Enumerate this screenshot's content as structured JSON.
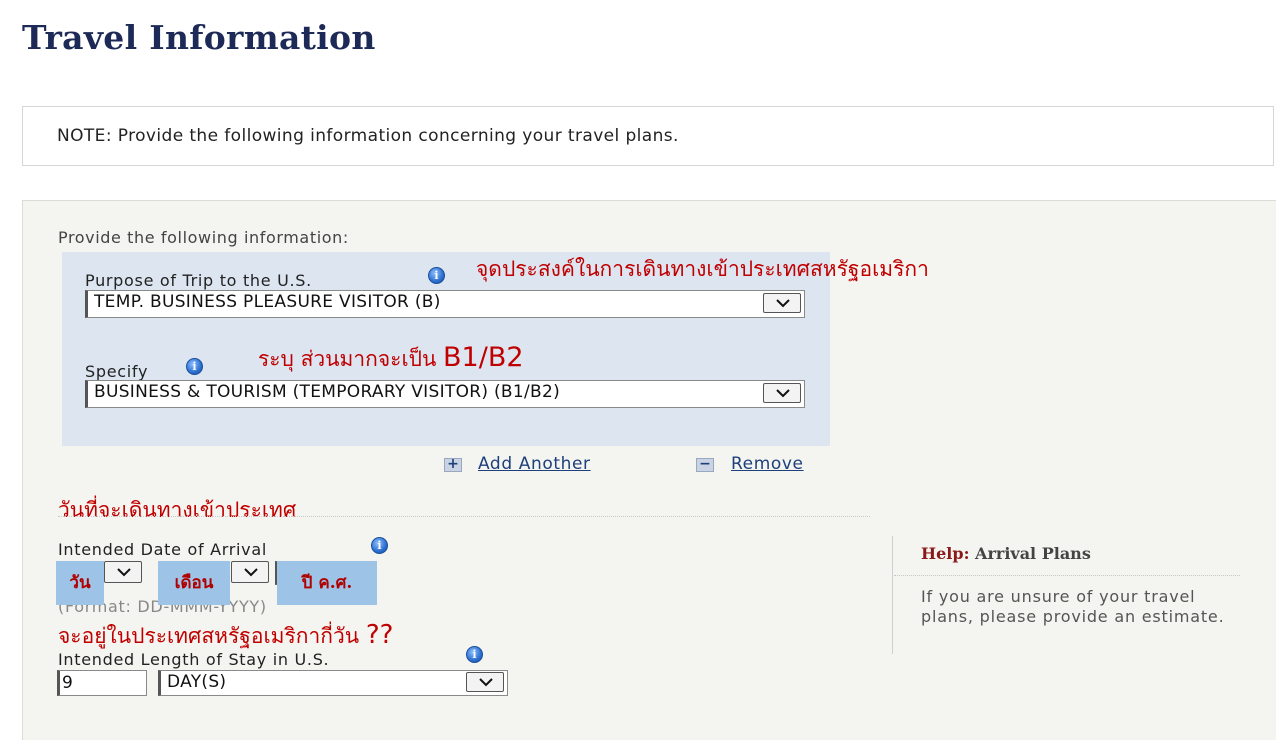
{
  "page": {
    "title": "Travel Information"
  },
  "note": {
    "text": "NOTE: Provide the following information concerning your travel plans."
  },
  "form": {
    "provide_label": "Provide the following information:",
    "purpose": {
      "label": "Purpose of Trip to the U.S.",
      "value": "TEMP. BUSINESS PLEASURE VISITOR (B)"
    },
    "specify": {
      "label": "Specify",
      "value": "BUSINESS & TOURISM (TEMPORARY VISITOR) (B1/B2)"
    },
    "add_another": "Add Another",
    "remove": "Remove",
    "arrival": {
      "label": "Intended Date of Arrival",
      "format": "(Format: DD-MMM-YYYY)"
    },
    "stay": {
      "label": "Intended Length of Stay in U.S.",
      "value": "9",
      "unit": "DAY(S)"
    }
  },
  "help": {
    "title_prefix": "Help:",
    "title_rest": " Arrival Plans",
    "text": "If you are unsure of your travel plans, please provide an estimate."
  },
  "annotations": {
    "purpose_note": "จุดประสงค์ในการเดินทางเข้าประเทศสหรัฐอเมริกา",
    "specify_note_thai": "ระบุ ส่วนมากจะเป็น ",
    "specify_note_code": "B1/B2",
    "arrival_note": "วันที่จะเดินทางเข้าประเทศ",
    "stay_note_thai": "จะอยู่ในประเทศสหรัฐอเมริกากี่วัน ",
    "stay_note_q": "??",
    "day_badge": "วัน",
    "month_badge": "เดือน",
    "year_badge": "ปี ค.ศ."
  },
  "colors": {
    "title": "#1d2a57",
    "annotation": "#c00000",
    "badge_bg": "#9dc3e6",
    "group_bg": "#dde6f0"
  }
}
